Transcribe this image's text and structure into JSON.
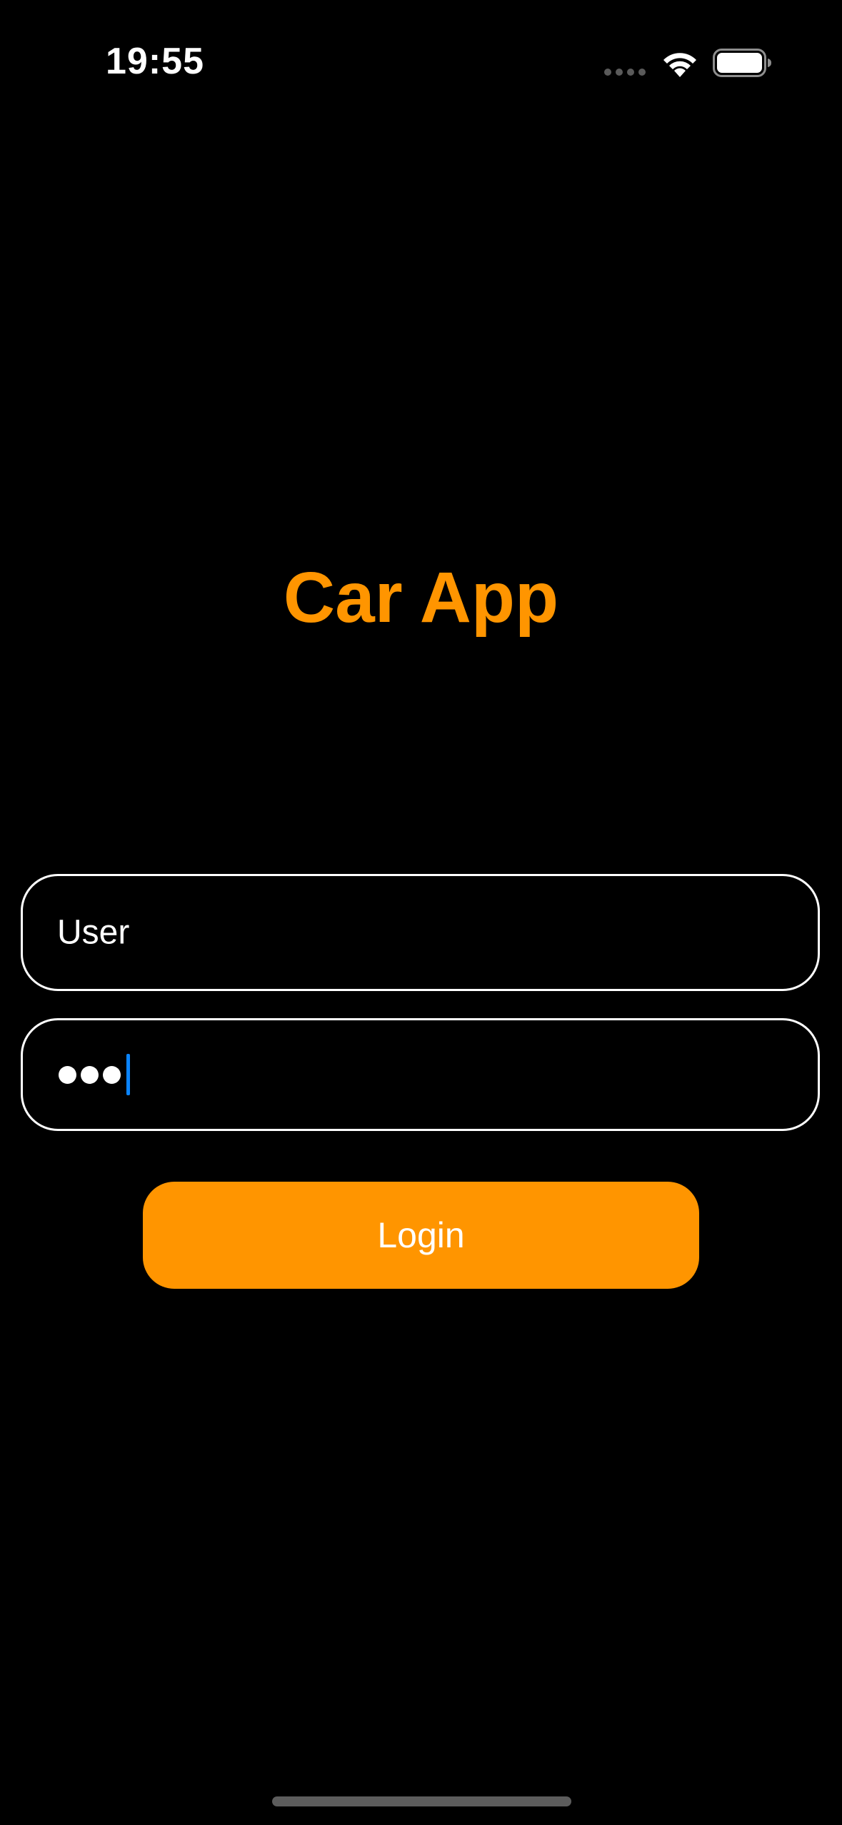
{
  "status_bar": {
    "time": "19:55",
    "icons": [
      "cellular-signal-icon",
      "wifi-icon",
      "battery-icon"
    ]
  },
  "app": {
    "title": "Car App",
    "accent_color": "#FF9500"
  },
  "form": {
    "username": {
      "value": "User"
    },
    "password": {
      "masked_length": 3,
      "focused": true
    },
    "login_button": {
      "label": "Login"
    }
  }
}
